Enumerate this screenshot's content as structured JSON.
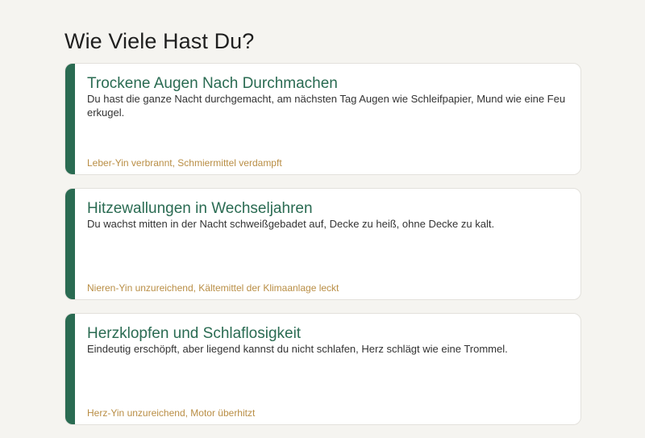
{
  "page": {
    "title": "Wie Viele Hast Du?"
  },
  "colors": {
    "accent": "#2a6b52",
    "note": "#b98e45",
    "background": "#f5f4f0"
  },
  "cards": [
    {
      "title": "Trockene Augen Nach Durchmachen",
      "description": "Du hast die ganze Nacht durchgemacht, am nächsten Tag Augen wie Schleifpapier, Mund wie eine Feuerkugel.",
      "note": "Leber-Yin verbrannt, Schmiermittel verdampft"
    },
    {
      "title": "Hitzewallungen in Wechseljahren",
      "description": "Du wachst mitten in der Nacht schweißgebadet auf, Decke zu heiß, ohne Decke zu kalt.",
      "note": "Nieren-Yin unzureichend, Kältemittel der Klimaanlage leckt"
    },
    {
      "title": "Herzklopfen und Schlaflosigkeit",
      "description": "Eindeutig erschöpft, aber liegend kannst du nicht schlafen, Herz schlägt wie eine Trommel.",
      "note": "Herz-Yin unzureichend, Motor überhitzt"
    }
  ]
}
